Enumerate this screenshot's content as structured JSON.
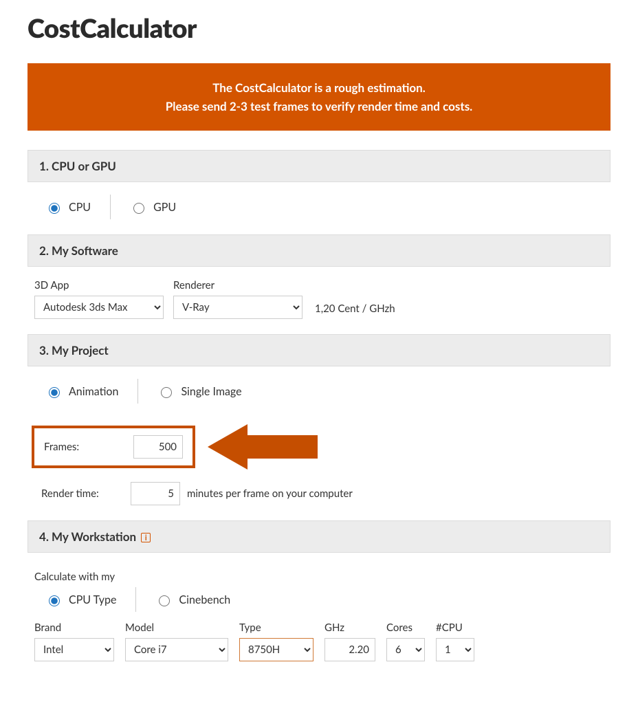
{
  "page": {
    "title": "CostCalculator",
    "notice_line1": "The CostCalculator is a rough estimation.",
    "notice_line2": "Please send 2-3 test frames to verify render time and costs."
  },
  "step1": {
    "header": "1. CPU or GPU",
    "opt_cpu": "CPU",
    "opt_gpu": "GPU"
  },
  "step2": {
    "header": "2. My Software",
    "label_app": "3D App",
    "label_renderer": "Renderer",
    "val_app": "Autodesk 3ds Max",
    "val_renderer": "V-Ray",
    "rate": "1,20 Cent / GHzh"
  },
  "step3": {
    "header": "3. My Project",
    "opt_anim": "Animation",
    "opt_single": "Single Image",
    "label_frames": "Frames:",
    "val_frames": "500",
    "label_rt": "Render time:",
    "val_rt": "5",
    "rt_suffix": "minutes per frame on your computer"
  },
  "step4": {
    "header": "4. My Workstation",
    "calc_with": "Calculate with my",
    "opt_cputype": "CPU Type",
    "opt_cinebench": "Cinebench",
    "label_brand": "Brand",
    "label_model": "Model",
    "label_type": "Type",
    "label_ghz": "GHz",
    "label_cores": "Cores",
    "label_ncpu": "#CPU",
    "val_brand": "Intel",
    "val_model": "Core i7",
    "val_type": "8750H",
    "val_ghz": "2.20",
    "val_cores": "6",
    "val_ncpu": "1"
  }
}
